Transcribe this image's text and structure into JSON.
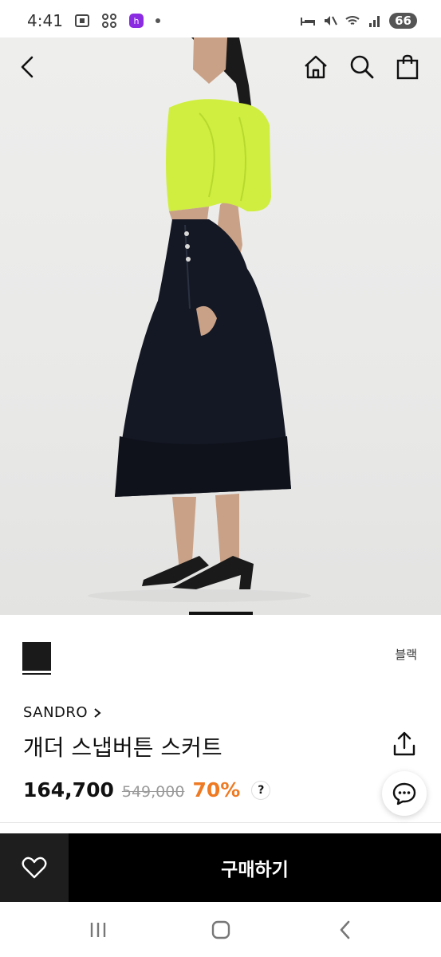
{
  "status_bar": {
    "time": "4:41",
    "battery": "66"
  },
  "product": {
    "color_name": "블랙",
    "brand": "SANDRO",
    "name": "개더 스냅버튼 스커트",
    "price": "164,700",
    "original_price": "549,000",
    "discount": "70%",
    "help": "?"
  },
  "actions": {
    "buy_label": "구매하기"
  },
  "colors": {
    "swatch": "#1a1a1a",
    "discount": "#ee7a23",
    "buy_bg": "#000000",
    "top_garment": "#cfee3f"
  }
}
